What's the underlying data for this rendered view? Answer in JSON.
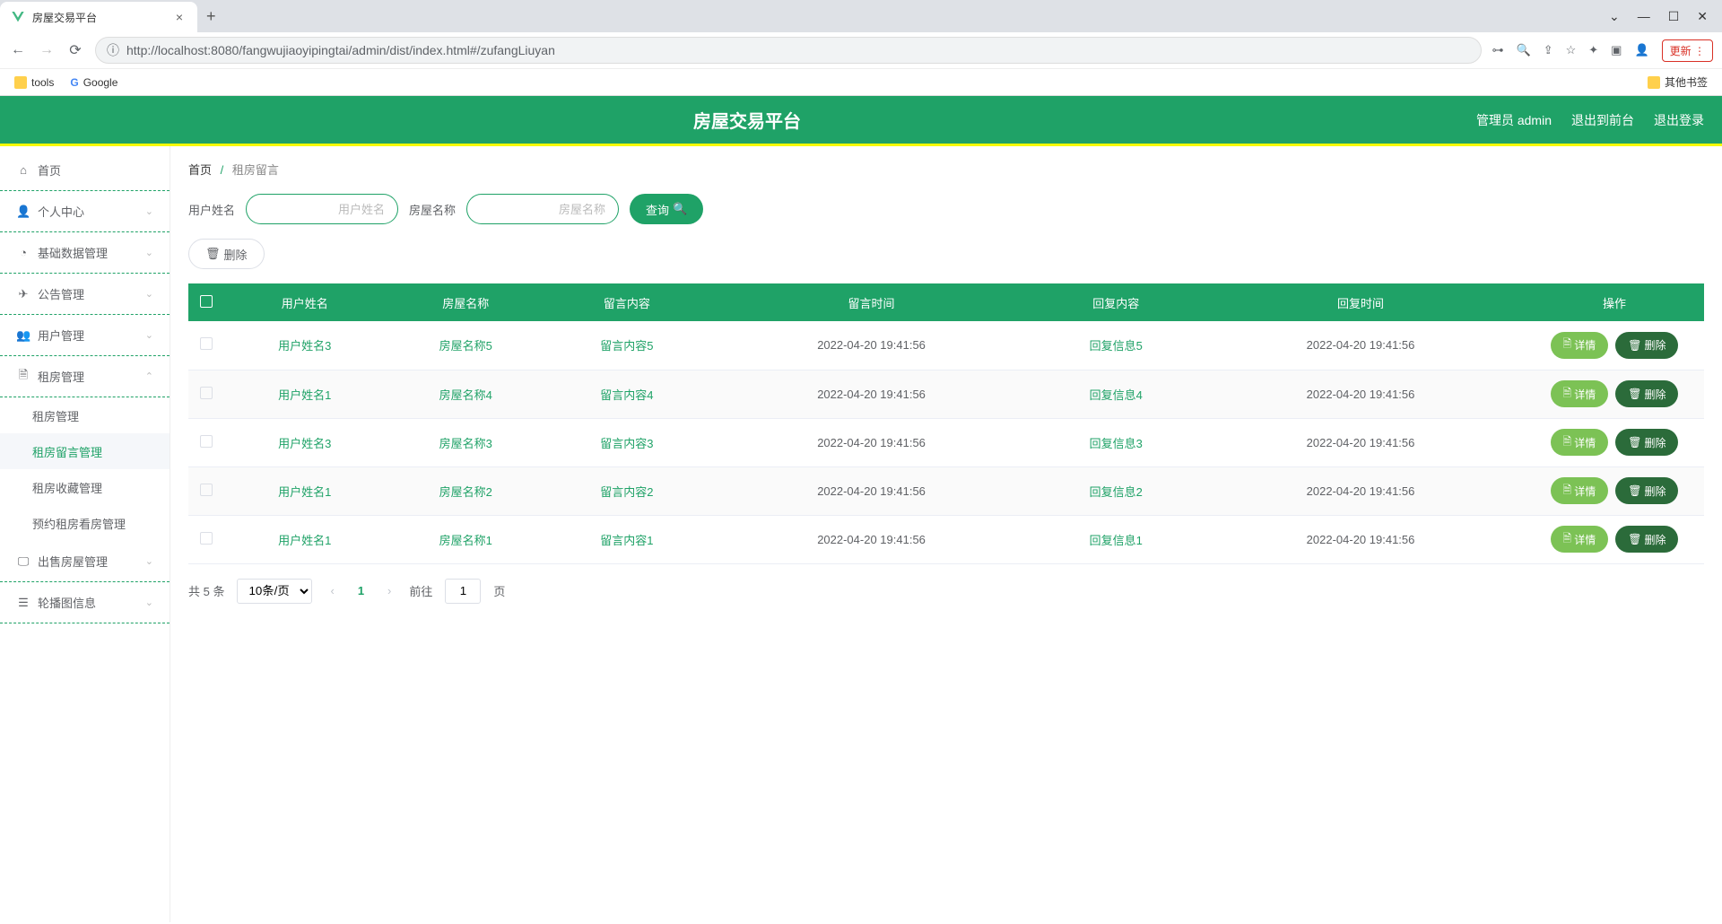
{
  "browser": {
    "tab_title": "房屋交易平台",
    "url": "http://localhost:8080/fangwujiaoyipingtai/admin/dist/index.html#/zufangLiuyan",
    "update_btn": "更新",
    "bookmarks": {
      "tools": "tools",
      "google": "Google",
      "other": "其他书签"
    }
  },
  "header": {
    "title": "房屋交易平台",
    "user": "管理员 admin",
    "to_front": "退出到前台",
    "logout": "退出登录"
  },
  "sidebar": {
    "home": "首页",
    "personal": "个人中心",
    "basedata": "基础数据管理",
    "notice": "公告管理",
    "user": "用户管理",
    "rent": "租房管理",
    "rent_sub": {
      "manage": "租房管理",
      "message": "租房留言管理",
      "collect": "租房收藏管理",
      "appoint": "预约租房看房管理"
    },
    "sale": "出售房屋管理",
    "banner": "轮播图信息"
  },
  "breadcrumb": {
    "home": "首页",
    "current": "租房留言"
  },
  "search": {
    "label_user": "用户姓名",
    "ph_user": "用户姓名",
    "label_house": "房屋名称",
    "ph_house": "房屋名称",
    "query_btn": "查询",
    "delete_btn": "删除"
  },
  "table": {
    "headers": [
      "用户姓名",
      "房屋名称",
      "留言内容",
      "留言时间",
      "回复内容",
      "回复时间",
      "操作"
    ],
    "detail_btn": "详情",
    "delete_btn": "删除",
    "rows": [
      {
        "user": "用户姓名3",
        "house": "房屋名称5",
        "msg": "留言内容5",
        "msg_time": "2022-04-20 19:41:56",
        "reply": "回复信息5",
        "reply_time": "2022-04-20 19:41:56"
      },
      {
        "user": "用户姓名1",
        "house": "房屋名称4",
        "msg": "留言内容4",
        "msg_time": "2022-04-20 19:41:56",
        "reply": "回复信息4",
        "reply_time": "2022-04-20 19:41:56"
      },
      {
        "user": "用户姓名3",
        "house": "房屋名称3",
        "msg": "留言内容3",
        "msg_time": "2022-04-20 19:41:56",
        "reply": "回复信息3",
        "reply_time": "2022-04-20 19:41:56"
      },
      {
        "user": "用户姓名1",
        "house": "房屋名称2",
        "msg": "留言内容2",
        "msg_time": "2022-04-20 19:41:56",
        "reply": "回复信息2",
        "reply_time": "2022-04-20 19:41:56"
      },
      {
        "user": "用户姓名1",
        "house": "房屋名称1",
        "msg": "留言内容1",
        "msg_time": "2022-04-20 19:41:56",
        "reply": "回复信息1",
        "reply_time": "2022-04-20 19:41:56"
      }
    ]
  },
  "pagination": {
    "total": "共 5 条",
    "page_size": "10条/页",
    "current": "1",
    "goto_prefix": "前往",
    "goto_value": "1",
    "goto_suffix": "页"
  }
}
